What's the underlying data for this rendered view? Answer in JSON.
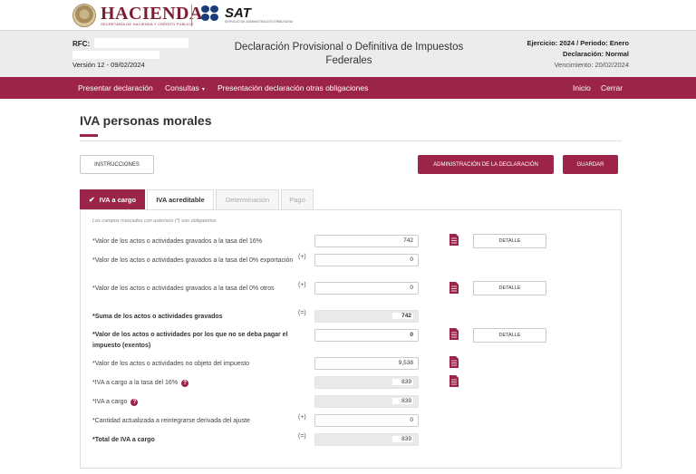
{
  "brand": {
    "hacienda_title": "HACIENDA",
    "hacienda_subtitle": "SECRETARÍA DE HACIENDA Y CRÉDITO PÚBLICO",
    "sat_title": "SAT",
    "sat_subtitle": "SERVICIO DE ADMINISTRACIÓN TRIBUTARIA",
    "color_primary": "#9d2449",
    "color_sat": "#1a3c7c"
  },
  "header": {
    "rfc_label": "RFC:",
    "version": "Versión 12 - 09/02/2024",
    "title": "Declaración Provisional o Definitiva de Impuestos Federales",
    "ejercicio": "Ejercicio: 2024 / Periodo: Enero",
    "declaracion": "Declaración: Normal",
    "vencimiento": "Vencimiento: 20/02/2024"
  },
  "nav": {
    "presentar": "Presentar declaración",
    "consultas": "Consultas",
    "otras": "Presentación declaración otras obligaciones",
    "inicio": "Inicio",
    "cerrar": "Cerrar"
  },
  "main": {
    "title": "IVA personas morales",
    "instrucciones": "INSTRUCCIONES",
    "administracion": "ADMINISTRACIÓN DE LA DECLARACIÓN",
    "guardar": "GUARDAR"
  },
  "tabs": [
    {
      "label": "IVA a cargo",
      "state": "active"
    },
    {
      "label": "IVA acreditable",
      "state": "enabled"
    },
    {
      "label": "Determinación",
      "state": "disabled"
    },
    {
      "label": "Pago",
      "state": "disabled"
    }
  ],
  "form": {
    "required_note": "Los campos marcados con asterisco (*) son obligatorios",
    "detalle": "DETALLE",
    "fields": [
      {
        "label": "*Valor de los actos o actividades gravados a la tasa del 16%",
        "operator": "",
        "value": "742"
      },
      {
        "label": "*Valor de los actos o actividades gravados a la tasa del 0% exportación",
        "operator": "(+)",
        "value": "0"
      },
      {
        "label": "*Valor de los actos o actividades gravados a la tasa del 0% otros",
        "operator": "(+)",
        "value": "0"
      },
      {
        "label": "*Suma de los actos o actividades gravados",
        "operator": "(=)",
        "value": "742"
      },
      {
        "label": "*Valor de los actos o actividades por los que no se deba pagar el impuesto (exentos)",
        "operator": "",
        "value": "0"
      },
      {
        "label": "*Valor de los actos o actividades no objeto del impuesto",
        "operator": "",
        "value": "9,538"
      },
      {
        "label": "*IVA a cargo a la tasa del 16%",
        "operator": "",
        "value": "839"
      },
      {
        "label": "*IVA a cargo",
        "operator": "",
        "value": "839"
      },
      {
        "label": "*Cantidad actualizada a reintegrarse derivada del ajuste",
        "operator": "(+)",
        "value": "0"
      },
      {
        "label": "*Total de IVA a cargo",
        "operator": "(=)",
        "value": "839"
      }
    ]
  }
}
